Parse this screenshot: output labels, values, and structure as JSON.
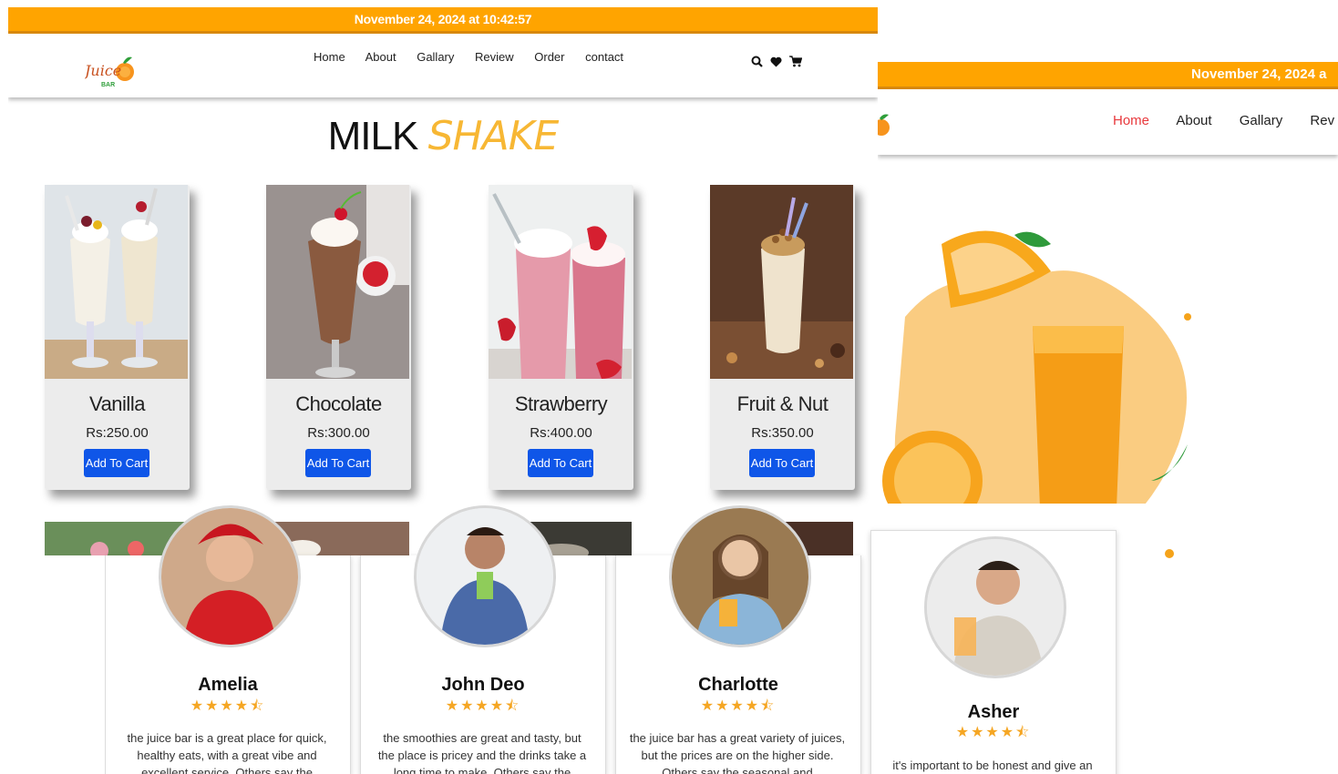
{
  "shot_a": {
    "topbar": "November 24, 2024 at 10:42:57",
    "logo_text": "Juice BAR",
    "nav": [
      "Home",
      "About",
      "Gallary",
      "Review",
      "Order",
      "contact"
    ],
    "title_part1": "MILK",
    "title_part2": "SHAKE",
    "products": [
      {
        "name": "Vanilla",
        "price": "Rs:250.00",
        "button": "Add To Cart"
      },
      {
        "name": "Chocolate",
        "price": "Rs:300.00",
        "button": "Add To Cart"
      },
      {
        "name": "Strawberry",
        "price": "Rs:400.00",
        "button": "Add To Cart"
      },
      {
        "name": "Fruit & Nut",
        "price": "Rs:350.00",
        "button": "Add To Cart"
      }
    ],
    "icons": [
      "search-icon",
      "heart-icon",
      "cart-icon"
    ]
  },
  "shot_b": {
    "topbar": "November 24, 2024 a",
    "nav": [
      "Home",
      "About",
      "Gallary",
      "Rev"
    ]
  },
  "reviews": [
    {
      "name": "Amelia",
      "stars": "★★★★⯪",
      "text": "the juice bar is a great place for quick, healthy eats, with a great vibe and excellent service. Others say the"
    },
    {
      "name": "John Deo",
      "stars": "★★★★⯪",
      "text": "the smoothies are great and tasty, but the place is pricey and the drinks take a long time to make. Others say the"
    },
    {
      "name": "Charlotte",
      "stars": "★★★★⯪",
      "text": "the juice bar has a great variety of juices, but the prices are on the higher side. Others say the seasonal and"
    },
    {
      "name": "Asher",
      "stars": "★★★★⯪",
      "text": "it's important to be honest and give an accurate portrayal of your experience. This helps other customers make"
    }
  ],
  "colors": {
    "accent": "#ffa400",
    "button": "#0f56e8",
    "title_accent": "#f7b734",
    "active_nav": "#e8383c"
  }
}
